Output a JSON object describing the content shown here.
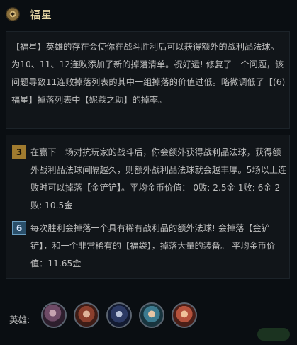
{
  "header": {
    "icon": "trait-emblem-icon",
    "title": "福星"
  },
  "description": "【福星】英雄的存在会使你在战斗胜利后可以获得额外的战利品法球。 为10、11、12连败添加了新的掉落清单。祝好运! 修复了一个问题，该问题导致11连败掉落列表的其中一组掉落的价值过低。略微调低了【(6)福星】掉落列表中【妮蔻之助】的掉率。",
  "tiers": [
    {
      "badge": "3",
      "text": "在赢下一场对抗玩家的战斗后，你会额外获得战利品法球，获得额外战利品法球间隔越久，则额外战利品法球就会越丰厚。5场以上连败时可以掉落【金铲铲】。平均金币价值： 0败: 2.5金 1败: 6金 2败: 10.5金"
    },
    {
      "badge": "6",
      "text": "每次胜利会掉落一个具有稀有战利品的额外法球! 会掉落【金铲铲】，和一个非常稀有的【福袋】，掉落大量的装备。 平均金币价值：11.65金"
    }
  ],
  "champions": {
    "label": "英雄:",
    "portraits": [
      "champion-portrait-1",
      "champion-portrait-2",
      "champion-portrait-3",
      "champion-portrait-4",
      "champion-portrait-5"
    ]
  },
  "colors": {
    "background": "#0a0e12",
    "title": "#e8d9a8",
    "tier3_badge": "#a07b2f",
    "tier6_badge": "#2a4f6a"
  }
}
